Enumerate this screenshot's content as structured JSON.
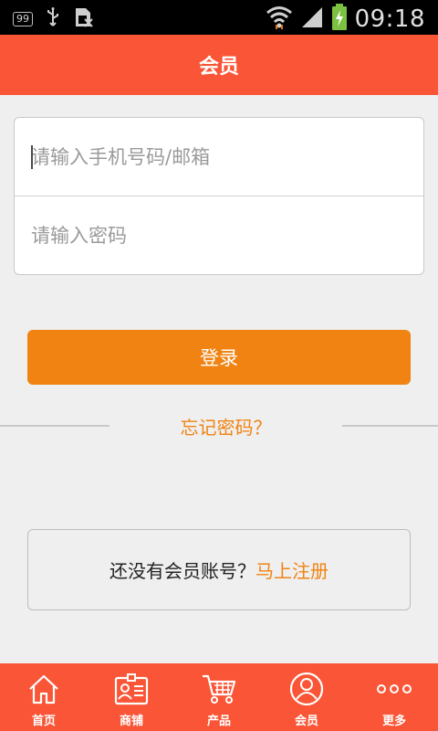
{
  "status_bar": {
    "badge": "99",
    "time": "09:18",
    "icons": [
      "usb-icon",
      "sim-icon",
      "wifi-icon",
      "signal-icon",
      "battery-charging-icon"
    ]
  },
  "header": {
    "title": "会员"
  },
  "login_form": {
    "phone_placeholder": "请输入手机号码/邮箱",
    "password_placeholder": "请输入密码",
    "phone_value": "",
    "password_value": ""
  },
  "login_button": {
    "label": "登录"
  },
  "forgot_password": {
    "label": "忘记密码？"
  },
  "register": {
    "prompt": "还没有会员账号？",
    "link": "马上注册"
  },
  "bottom_nav": {
    "items": [
      {
        "label": "首页",
        "icon": "home-icon"
      },
      {
        "label": "商铺",
        "icon": "shop-badge-icon"
      },
      {
        "label": "产品",
        "icon": "cart-icon"
      },
      {
        "label": "会员",
        "icon": "member-icon"
      },
      {
        "label": "更多",
        "icon": "more-icon"
      }
    ]
  },
  "colors": {
    "brand_red": "#f95536",
    "accent_orange": "#f08312",
    "background": "#efefef"
  }
}
